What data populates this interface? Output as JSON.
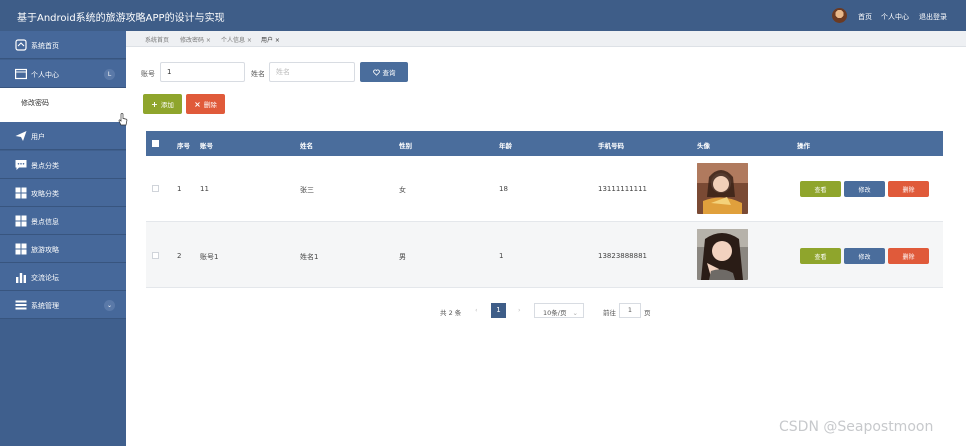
{
  "header": {
    "title": "基于Android系统的旅游攻略APP的设计与实现",
    "links": [
      "首页",
      "个人中心",
      "退出登录"
    ]
  },
  "sidebar": {
    "items": [
      {
        "label": "系统首页",
        "icon": "home-icon"
      },
      {
        "label": "个人中心",
        "icon": "window-icon",
        "badge": "L"
      },
      {
        "label": "用户",
        "icon": "send-icon"
      },
      {
        "label": "景点分类",
        "icon": "chat-icon"
      },
      {
        "label": "攻略分类",
        "icon": "grid-icon"
      },
      {
        "label": "景点信息",
        "icon": "grid-icon"
      },
      {
        "label": "旅游攻略",
        "icon": "grid-icon"
      },
      {
        "label": "交流论坛",
        "icon": "bar-chart-icon"
      },
      {
        "label": "系统管理",
        "icon": "menu-icon"
      }
    ],
    "sub_item": "修改密码"
  },
  "tabs": [
    "系统首页",
    "修改密码 ×",
    "个人信息 ×",
    "用户 ×"
  ],
  "search": {
    "account_label": "账号",
    "account_value": "1",
    "name_label": "姓名",
    "name_placeholder": "姓名",
    "query_label": "查询"
  },
  "actions": {
    "add_label": "添加",
    "delete_label": "删除"
  },
  "table": {
    "columns": [
      "序号",
      "账号",
      "姓名",
      "性别",
      "年龄",
      "手机号码",
      "头像",
      "操作"
    ],
    "rows": [
      {
        "index": "1",
        "account": "11",
        "name": "张三",
        "gender": "女",
        "age": "18",
        "phone": "13111111111"
      },
      {
        "index": "2",
        "account": "账号1",
        "name": "姓名1",
        "gender": "男",
        "age": "1",
        "phone": "13823888881"
      }
    ],
    "row_actions": {
      "view": "查看",
      "edit": "修改",
      "delete": "删除"
    }
  },
  "pagination": {
    "total": "共 2 条",
    "prev": "‹",
    "current_page": "1",
    "next": "›",
    "page_size": "10条/页",
    "goto_prefix": "前往",
    "goto_value": "1",
    "goto_suffix": "页"
  },
  "watermark": "CSDN @Seapostmoon",
  "colors": {
    "header": "#3e5d88",
    "sidebar": "#3f5f8d",
    "accent_green": "#8fa52c",
    "accent_red": "#e05a3a",
    "accent_blue": "#4a6d9c"
  }
}
